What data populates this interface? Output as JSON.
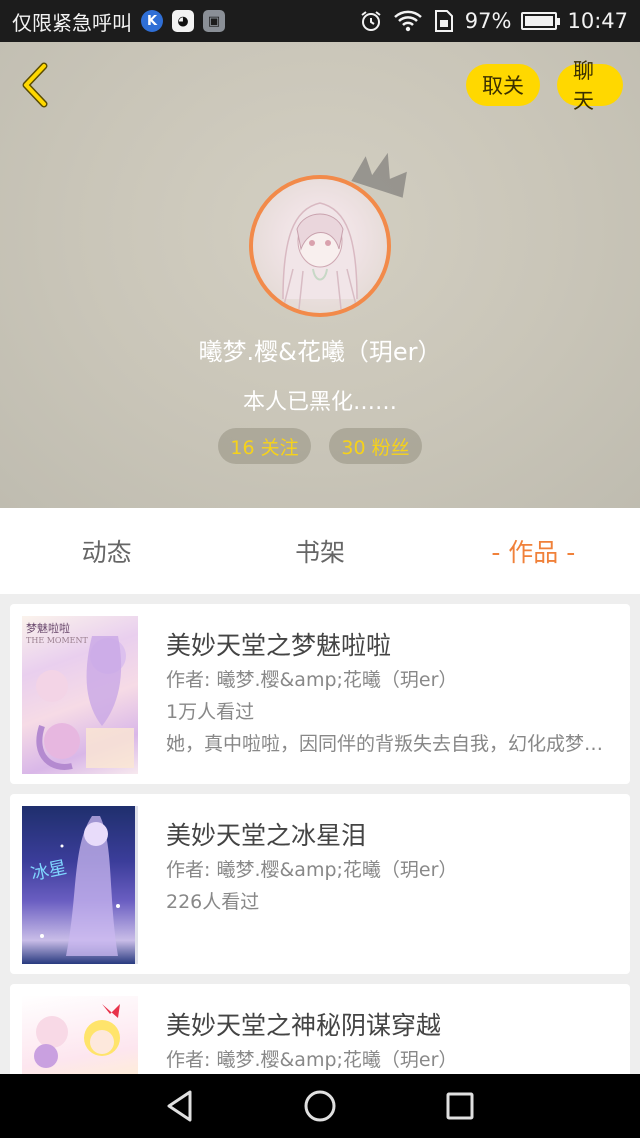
{
  "status_bar": {
    "carrier": "仅限紧急呼叫",
    "battery": "97%",
    "battery_level": 0.97,
    "time": "10:47",
    "icons": [
      "k-app-icon",
      "qq-icon",
      "image-icon",
      "alarm-icon",
      "wifi-icon",
      "sim-icon",
      "battery-icon"
    ]
  },
  "header": {
    "back_icon": "chevron-left-icon",
    "unfollow_label": "取关",
    "chat_label": "聊天",
    "nickname": "曦梦.樱&花曦（玥er）",
    "signature": "本人已黑化……",
    "following": "16 关注",
    "fans": "30 粉丝",
    "accent_color": "#ffd800"
  },
  "tabs": [
    {
      "label": "动态",
      "active": false
    },
    {
      "label": "书架",
      "active": false
    },
    {
      "label": "- 作品 -",
      "active": true
    }
  ],
  "works": [
    {
      "title": "美妙天堂之梦魅啦啦",
      "author": "作者: 曦梦.樱&amp;花曦（玥er）",
      "views": "1万人看过",
      "desc": "她，真中啦啦，因同伴的背叛失去自我，幻化成梦魅啦啦，她决心要向背叛她的人复仇",
      "cover_text": "梦魅啦啦",
      "cover_subtext": "THE MOMENT"
    },
    {
      "title": "美妙天堂之冰星泪",
      "author": "作者: 曦梦.樱&amp;花曦（玥er）",
      "views": "226人看过"
    },
    {
      "title": "美妙天堂之神秘阴谋穿越",
      "author": "作者: 曦梦.樱&amp;花曦（玥er）"
    }
  ],
  "nav": {
    "back": "triangle-back-icon",
    "home": "circle-home-icon",
    "recent": "square-recent-icon"
  }
}
